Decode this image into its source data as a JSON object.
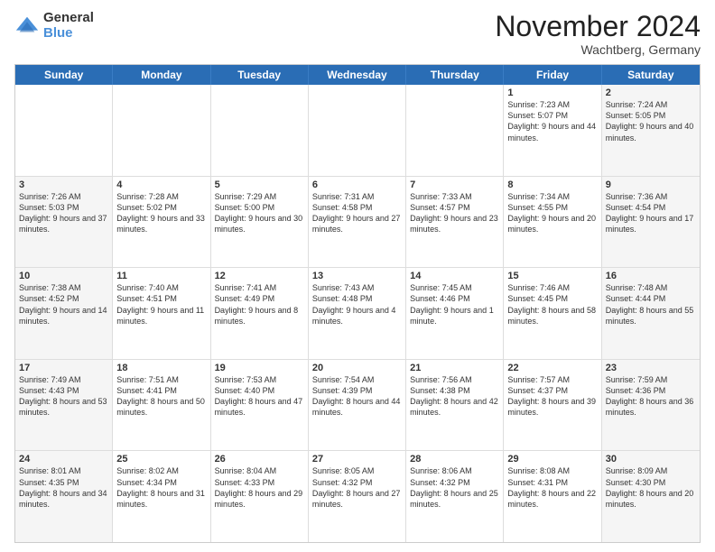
{
  "logo": {
    "general": "General",
    "blue": "Blue"
  },
  "title": "November 2024",
  "location": "Wachtberg, Germany",
  "days_of_week": [
    "Sunday",
    "Monday",
    "Tuesday",
    "Wednesday",
    "Thursday",
    "Friday",
    "Saturday"
  ],
  "weeks": [
    [
      {
        "day": "",
        "info": ""
      },
      {
        "day": "",
        "info": ""
      },
      {
        "day": "",
        "info": ""
      },
      {
        "day": "",
        "info": ""
      },
      {
        "day": "",
        "info": ""
      },
      {
        "day": "1",
        "info": "Sunrise: 7:23 AM\nSunset: 5:07 PM\nDaylight: 9 hours and 44 minutes."
      },
      {
        "day": "2",
        "info": "Sunrise: 7:24 AM\nSunset: 5:05 PM\nDaylight: 9 hours and 40 minutes."
      }
    ],
    [
      {
        "day": "3",
        "info": "Sunrise: 7:26 AM\nSunset: 5:03 PM\nDaylight: 9 hours and 37 minutes."
      },
      {
        "day": "4",
        "info": "Sunrise: 7:28 AM\nSunset: 5:02 PM\nDaylight: 9 hours and 33 minutes."
      },
      {
        "day": "5",
        "info": "Sunrise: 7:29 AM\nSunset: 5:00 PM\nDaylight: 9 hours and 30 minutes."
      },
      {
        "day": "6",
        "info": "Sunrise: 7:31 AM\nSunset: 4:58 PM\nDaylight: 9 hours and 27 minutes."
      },
      {
        "day": "7",
        "info": "Sunrise: 7:33 AM\nSunset: 4:57 PM\nDaylight: 9 hours and 23 minutes."
      },
      {
        "day": "8",
        "info": "Sunrise: 7:34 AM\nSunset: 4:55 PM\nDaylight: 9 hours and 20 minutes."
      },
      {
        "day": "9",
        "info": "Sunrise: 7:36 AM\nSunset: 4:54 PM\nDaylight: 9 hours and 17 minutes."
      }
    ],
    [
      {
        "day": "10",
        "info": "Sunrise: 7:38 AM\nSunset: 4:52 PM\nDaylight: 9 hours and 14 minutes."
      },
      {
        "day": "11",
        "info": "Sunrise: 7:40 AM\nSunset: 4:51 PM\nDaylight: 9 hours and 11 minutes."
      },
      {
        "day": "12",
        "info": "Sunrise: 7:41 AM\nSunset: 4:49 PM\nDaylight: 9 hours and 8 minutes."
      },
      {
        "day": "13",
        "info": "Sunrise: 7:43 AM\nSunset: 4:48 PM\nDaylight: 9 hours and 4 minutes."
      },
      {
        "day": "14",
        "info": "Sunrise: 7:45 AM\nSunset: 4:46 PM\nDaylight: 9 hours and 1 minute."
      },
      {
        "day": "15",
        "info": "Sunrise: 7:46 AM\nSunset: 4:45 PM\nDaylight: 8 hours and 58 minutes."
      },
      {
        "day": "16",
        "info": "Sunrise: 7:48 AM\nSunset: 4:44 PM\nDaylight: 8 hours and 55 minutes."
      }
    ],
    [
      {
        "day": "17",
        "info": "Sunrise: 7:49 AM\nSunset: 4:43 PM\nDaylight: 8 hours and 53 minutes."
      },
      {
        "day": "18",
        "info": "Sunrise: 7:51 AM\nSunset: 4:41 PM\nDaylight: 8 hours and 50 minutes."
      },
      {
        "day": "19",
        "info": "Sunrise: 7:53 AM\nSunset: 4:40 PM\nDaylight: 8 hours and 47 minutes."
      },
      {
        "day": "20",
        "info": "Sunrise: 7:54 AM\nSunset: 4:39 PM\nDaylight: 8 hours and 44 minutes."
      },
      {
        "day": "21",
        "info": "Sunrise: 7:56 AM\nSunset: 4:38 PM\nDaylight: 8 hours and 42 minutes."
      },
      {
        "day": "22",
        "info": "Sunrise: 7:57 AM\nSunset: 4:37 PM\nDaylight: 8 hours and 39 minutes."
      },
      {
        "day": "23",
        "info": "Sunrise: 7:59 AM\nSunset: 4:36 PM\nDaylight: 8 hours and 36 minutes."
      }
    ],
    [
      {
        "day": "24",
        "info": "Sunrise: 8:01 AM\nSunset: 4:35 PM\nDaylight: 8 hours and 34 minutes."
      },
      {
        "day": "25",
        "info": "Sunrise: 8:02 AM\nSunset: 4:34 PM\nDaylight: 8 hours and 31 minutes."
      },
      {
        "day": "26",
        "info": "Sunrise: 8:04 AM\nSunset: 4:33 PM\nDaylight: 8 hours and 29 minutes."
      },
      {
        "day": "27",
        "info": "Sunrise: 8:05 AM\nSunset: 4:32 PM\nDaylight: 8 hours and 27 minutes."
      },
      {
        "day": "28",
        "info": "Sunrise: 8:06 AM\nSunset: 4:32 PM\nDaylight: 8 hours and 25 minutes."
      },
      {
        "day": "29",
        "info": "Sunrise: 8:08 AM\nSunset: 4:31 PM\nDaylight: 8 hours and 22 minutes."
      },
      {
        "day": "30",
        "info": "Sunrise: 8:09 AM\nSunset: 4:30 PM\nDaylight: 8 hours and 20 minutes."
      }
    ]
  ]
}
